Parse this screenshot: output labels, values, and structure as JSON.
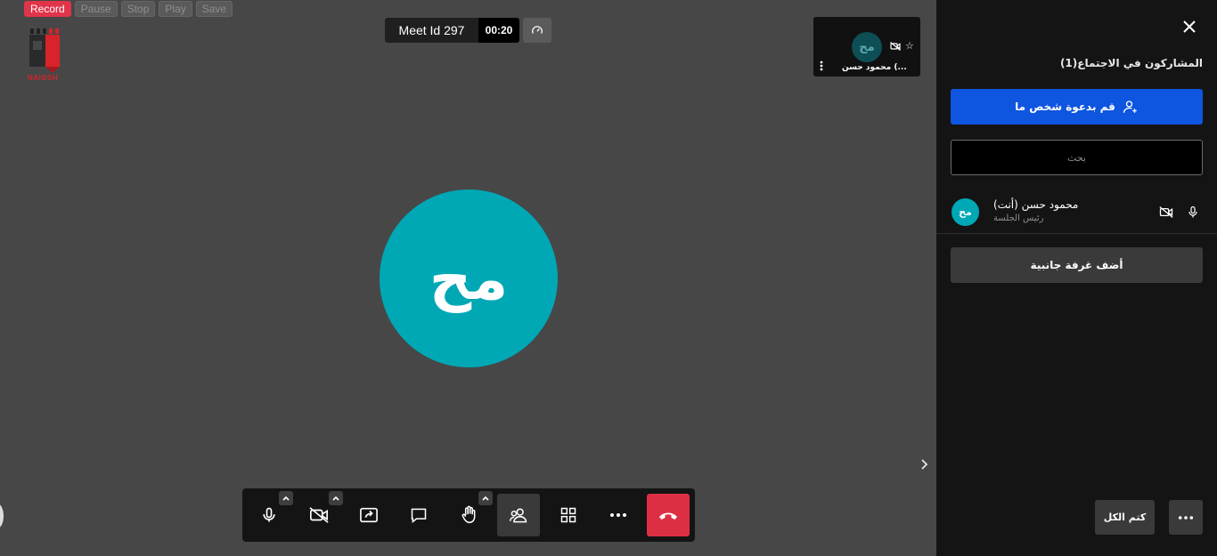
{
  "recorder": {
    "record": "Record",
    "pause": "Pause",
    "stop": "Stop",
    "play": "Play",
    "save": "Save"
  },
  "logo": {
    "text": "NAIOSH"
  },
  "meeting": {
    "meet_id": "Meet Id 297",
    "timer": "00:20"
  },
  "thumbnail": {
    "initials": "مح",
    "name": "محمود حسن (..."
  },
  "main": {
    "initials": "مح"
  },
  "toolbar": {
    "icons": [
      "microphone-icon",
      "camera-off-icon",
      "share-screen-icon",
      "chat-icon",
      "raise-hand-icon",
      "participants-icon",
      "tile-view-icon",
      "more-icon",
      "hangup-icon"
    ]
  },
  "panel": {
    "title": "المشاركون في الاجتماع(1)",
    "invite_label": "قم بدعوة شخص ما",
    "search_placeholder": "بحث",
    "participants": [
      {
        "initials": "مح",
        "name": "محمود حسن (أنت)",
        "role": "رئيس الجلسة"
      }
    ],
    "breakout_label": "أضف غرفة جانبية",
    "mute_all_label": "كتم الكل"
  },
  "colors": {
    "background": "#474747",
    "panel": "#141414",
    "accent_blue": "#0e55e0",
    "avatar_teal": "#00a7b5",
    "hangup_red": "#dd2f44",
    "record_red": "#e0344a"
  }
}
